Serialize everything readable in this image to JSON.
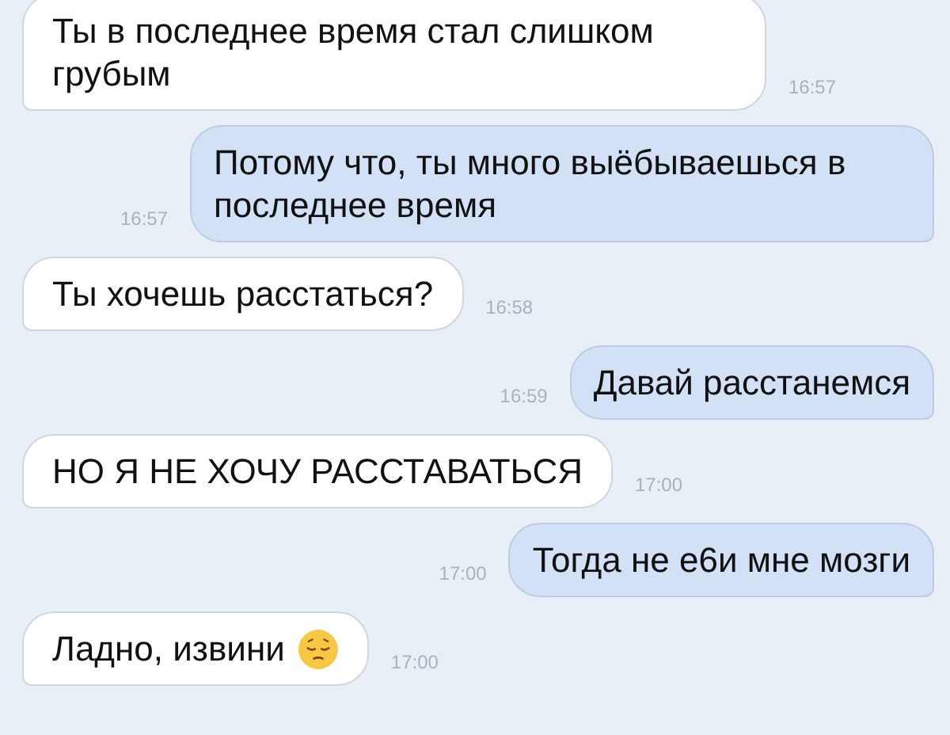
{
  "messages": [
    {
      "kind": "incoming",
      "text": "Ты в последнее время стал слишком грубым",
      "time": "16:57"
    },
    {
      "kind": "outgoing",
      "text": "Потому что, ты много выёбываешься в последнее время",
      "time": "16:57"
    },
    {
      "kind": "incoming",
      "text": "Ты хочешь расстаться?",
      "time": "16:58"
    },
    {
      "kind": "outgoing",
      "text": "Давай расстанемся",
      "time": "16:59"
    },
    {
      "kind": "incoming",
      "text": "НО Я НЕ ХОЧУ РАССТАВАТЬСЯ",
      "time": "17:00"
    },
    {
      "kind": "outgoing",
      "text": "Тогда не е6и мне мозги",
      "time": "17:00"
    },
    {
      "kind": "incoming",
      "text": "Ладно, извини",
      "emoji": true,
      "time": "17:00"
    }
  ]
}
